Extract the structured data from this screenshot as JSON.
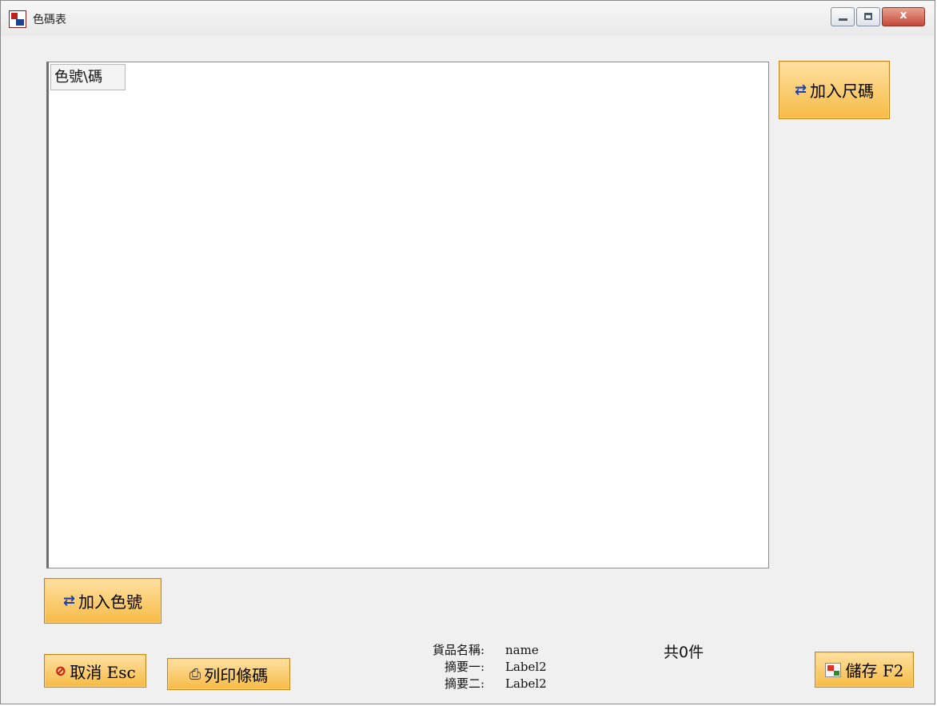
{
  "window": {
    "title": "色碼表",
    "controls": {
      "minimize": "",
      "maximize": "",
      "close": "x"
    }
  },
  "grid": {
    "corner_header": "色號\\碼"
  },
  "buttons": {
    "add_size": "加入尺碼",
    "add_color": "加入色號",
    "cancel": "取消 Esc",
    "print_barcode": "列印條碼",
    "save": "儲存 F2"
  },
  "info": {
    "product_name_label": "貨品名稱:",
    "product_name_value": "name",
    "summary1_label": "摘要一:",
    "summary1_value": "Label2",
    "summary2_label": "摘要二:",
    "summary2_value": "Label2",
    "count_text": "共0件"
  },
  "icons": {
    "app": "app-icon",
    "add_size": "add-columns-icon",
    "add_color": "add-rows-icon",
    "cancel": "no-entry-icon",
    "print": "printer-icon",
    "save": "save-icon"
  },
  "colors": {
    "button_bg": "#f6bb46",
    "button_border": "#c58417",
    "window_bg": "#f0f0f0",
    "close_button": "#c4493a"
  }
}
